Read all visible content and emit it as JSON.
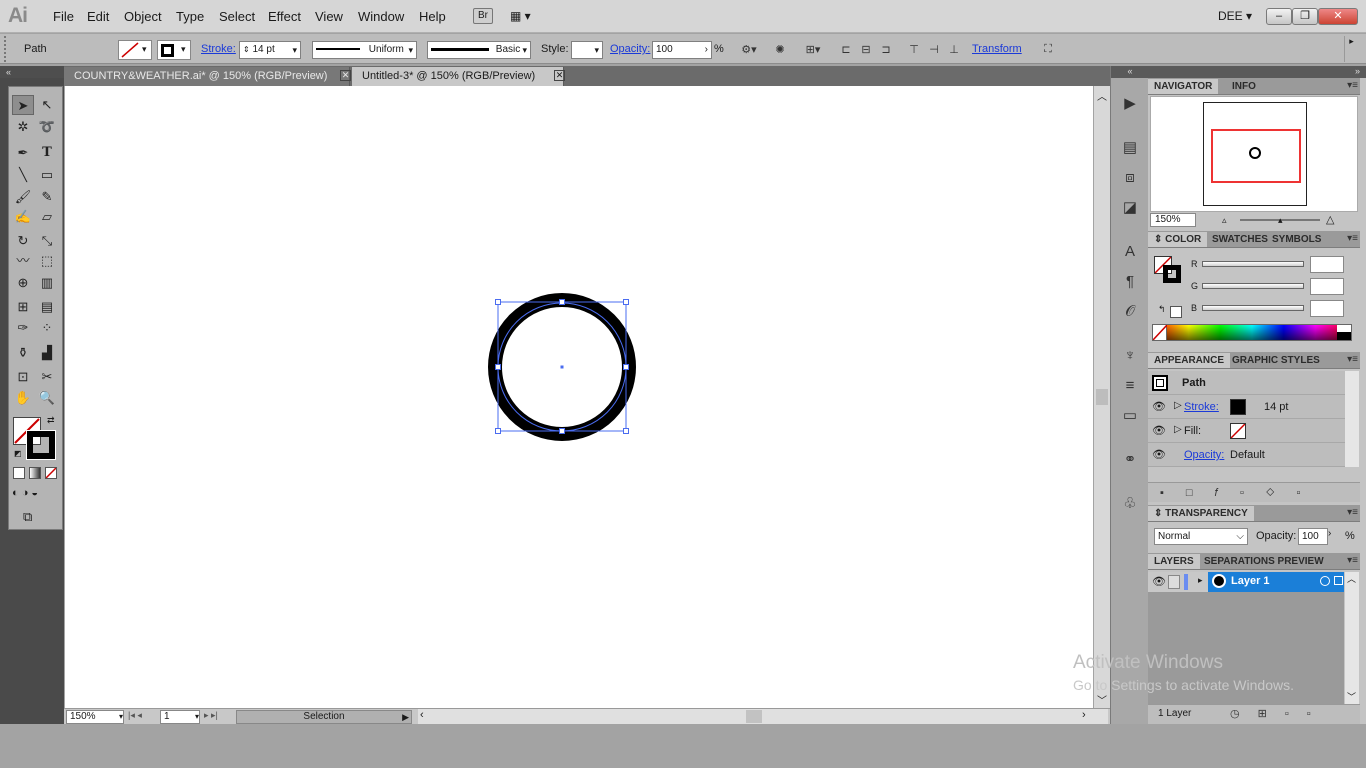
{
  "app": {
    "logo": "Ai",
    "user": "DEE",
    "bridge": "Br"
  },
  "menu": [
    "File",
    "Edit",
    "Object",
    "Type",
    "Select",
    "Effect",
    "View",
    "Window",
    "Help"
  ],
  "control": {
    "selection_type": "Path",
    "stroke_label": "Stroke:",
    "stroke_weight": "14 pt",
    "profile": "Uniform",
    "brush": "Basic",
    "style_label": "Style:",
    "opacity_label": "Opacity:",
    "opacity_value": "100",
    "percent": "%",
    "transform_label": "Transform"
  },
  "tabs": [
    {
      "label": "COUNTRY&WEATHER.ai* @ 150% (RGB/Preview)"
    },
    {
      "label": "Untitled-3* @ 150% (RGB/Preview)"
    }
  ],
  "status": {
    "zoom": "150%",
    "page": "1",
    "tool": "Selection"
  },
  "navigator": {
    "tab": "NAVIGATOR",
    "tab2": "INFO",
    "zoom": "150%"
  },
  "color": {
    "tabs": [
      "COLOR",
      "SWATCHES",
      "SYMBOLS"
    ],
    "channels": [
      "R",
      "G",
      "B"
    ]
  },
  "appearance": {
    "tabs": [
      "APPEARANCE",
      "GRAPHIC STYLES"
    ],
    "title": "Path",
    "stroke_label": "Stroke:",
    "stroke_value": "14 pt",
    "fill_label": "Fill:",
    "opacity_label": "Opacity:",
    "opacity_value": "Default"
  },
  "transparency": {
    "tab": "TRANSPARENCY",
    "mode": "Normal",
    "opacity_label": "Opacity:",
    "opacity_value": "100",
    "percent": "%"
  },
  "layers": {
    "tabs": [
      "LAYERS",
      "SEPARATIONS PREVIEW"
    ],
    "layer_name": "Layer 1",
    "count": "1 Layer"
  },
  "watermark": {
    "line1": "Activate Windows",
    "line2": "Go to Settings to activate Windows."
  },
  "colors": {
    "selection": "#4a6cf0",
    "layer_highlight": "#1b7fd8",
    "link": "#1b3ad8"
  }
}
